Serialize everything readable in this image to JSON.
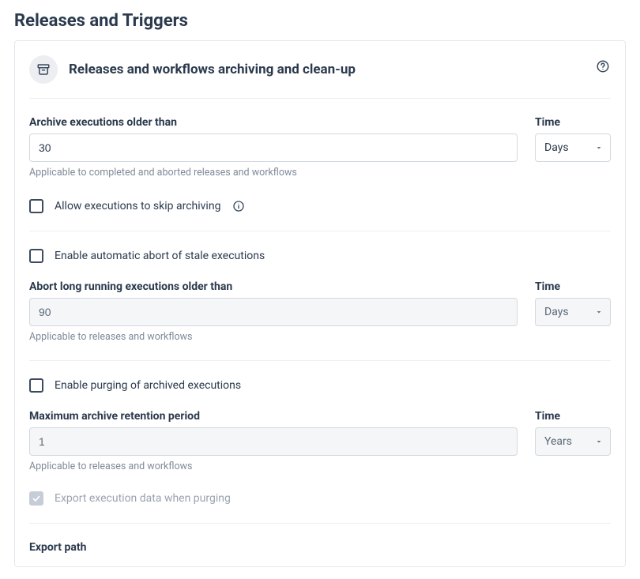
{
  "page": {
    "title": "Releases and Triggers"
  },
  "section": {
    "title": "Releases and workflows archiving and clean-up"
  },
  "archive": {
    "label": "Archive executions older than",
    "value": "30",
    "hint": "Applicable to completed and aborted releases and workflows",
    "time_label": "Time",
    "time_value": "Days"
  },
  "skip_archiving": {
    "label": "Allow executions to skip archiving"
  },
  "auto_abort": {
    "label": "Enable automatic abort of stale executions"
  },
  "abort_long": {
    "label": "Abort long running executions older than",
    "value": "90",
    "hint": "Applicable to releases and workflows",
    "time_label": "Time",
    "time_value": "Days"
  },
  "purge": {
    "label": "Enable purging of archived executions"
  },
  "retention": {
    "label": "Maximum archive retention period",
    "value": "1",
    "hint": "Applicable to releases and workflows",
    "time_label": "Time",
    "time_value": "Years"
  },
  "export_on_purge": {
    "label": "Export execution data when purging"
  },
  "export_path": {
    "label": "Export path"
  }
}
